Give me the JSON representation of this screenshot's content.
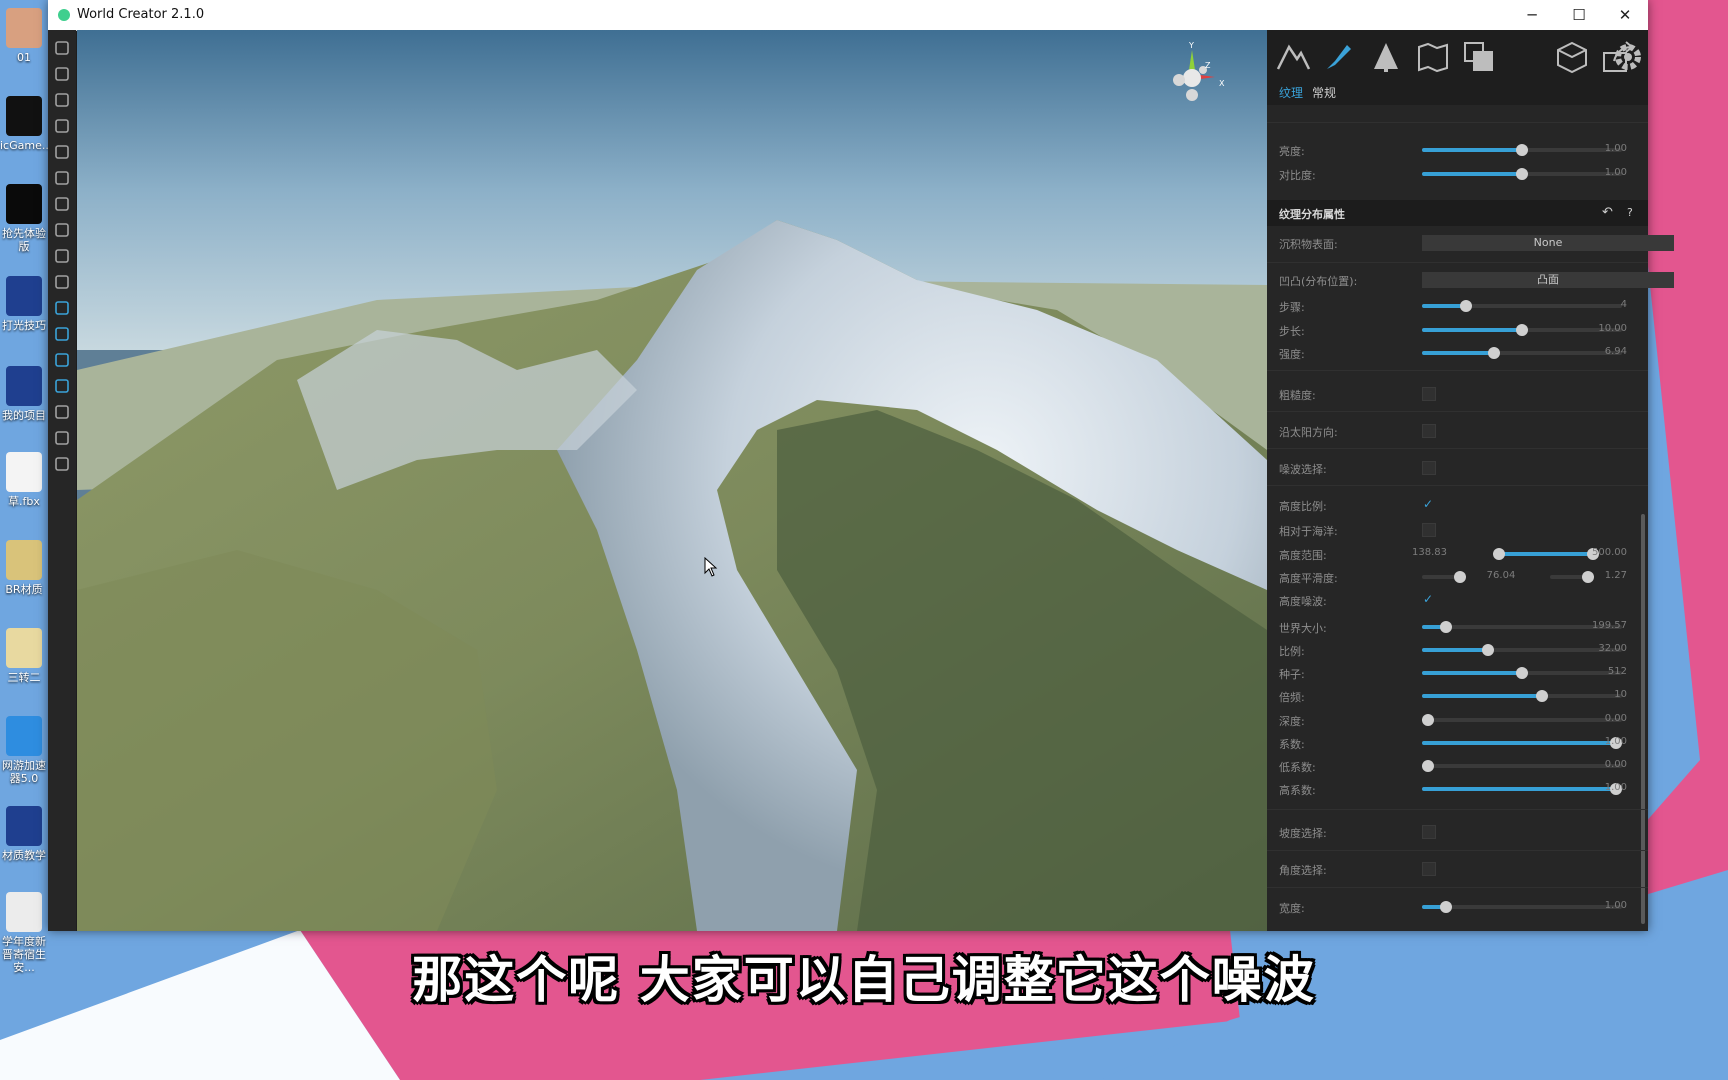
{
  "window": {
    "title": "World Creator 2.1.0",
    "minimize": "─",
    "maximize": "☐",
    "close": "✕"
  },
  "desktop_icons": [
    {
      "label": "01",
      "color": "#d8a080"
    },
    {
      "label": "icGame...",
      "color": "#111111"
    },
    {
      "label": "抢先体验版",
      "color": "#0a0a0a"
    },
    {
      "label": "打光技巧",
      "color": "#1f3f8f"
    },
    {
      "label": "我的项目",
      "color": "#1f3f8f"
    },
    {
      "label": "草.fbx",
      "color": "#f4f4f4"
    },
    {
      "label": "BR材质",
      "color": "#d9c37a"
    },
    {
      "label": "三转二",
      "color": "#e8d9a0"
    },
    {
      "label": "网游加速器5.0",
      "color": "#2e8de0"
    },
    {
      "label": "材质教学",
      "color": "#1f3f8f"
    },
    {
      "label": "学年度新晋寄宿生安...",
      "color": "#ececec"
    }
  ],
  "left_toolbar_icons": [
    "new-file-icon",
    "open-folder-icon",
    "save-icon",
    "save-as-icon",
    "export-icon",
    "map-icon",
    "gamepad-icon",
    "brush-icon",
    "target-icon",
    "terrain-icon",
    "mountain-icon",
    "paint-icon",
    "water-icon",
    "grass-icon",
    "road-icon",
    "image-icon",
    "sky-icon"
  ],
  "gizmo": {
    "y": "Y",
    "z": "Z",
    "x": "X"
  },
  "panel": {
    "top_icons": [
      "mountain-icon",
      "brush-icon",
      "tree-icon",
      "map-icon",
      "layers-icon",
      "cube-icon",
      "share-icon",
      "gear-icon"
    ],
    "tabs": {
      "texture": "纹理",
      "general": "常规"
    },
    "brightness": {
      "label": "亮度:",
      "value": "1.00",
      "level": 0.5
    },
    "contrast": {
      "label": "对比度:",
      "value": "1.00",
      "level": 0.5
    },
    "section_title": "纹理分布属性",
    "section_icons": {
      "undo": "↶",
      "help": "?"
    },
    "sediment": {
      "label": "沉积物表面:",
      "value": "None"
    },
    "convexity": {
      "label": "凹凸(分布位置):",
      "value": "凸面"
    },
    "sliders_a": [
      {
        "label": "步骤:",
        "value": "4",
        "level": 0.22
      },
      {
        "label": "步长:",
        "value": "10.00",
        "level": 0.5
      },
      {
        "label": "强度:",
        "value": "6.94",
        "level": 0.36
      }
    ],
    "roughness": {
      "label": "粗糙度:"
    },
    "sun_dir": {
      "label": "沿太阳方向:"
    },
    "noise_sel": {
      "label": "噪波选择:"
    },
    "height_ratio": {
      "label": "高度比例:",
      "check": "✓"
    },
    "relative_ocean": {
      "label": "相对于海洋:"
    },
    "height_range": {
      "label": "高度范围:",
      "min": "138.83",
      "max": "500.00",
      "lo": 0.0,
      "hi": 1.0
    },
    "height_smooth": {
      "label": "高度平滑度:",
      "mid": "76.04",
      "right": "1.27"
    },
    "height_noise": {
      "label": "高度噪波:",
      "check": "✓"
    },
    "sliders_b": [
      {
        "label": "世界大小:",
        "value": "199.57",
        "level": 0.12
      },
      {
        "label": "比例:",
        "value": "32.00",
        "level": 0.33
      },
      {
        "label": "种子:",
        "value": "512",
        "level": 0.5
      },
      {
        "label": "倍频:",
        "value": "10",
        "level": 0.6
      },
      {
        "label": "深度:",
        "value": "0.00",
        "level": 0.03
      },
      {
        "label": "系数:",
        "value": "1.00",
        "level": 0.97
      },
      {
        "label": "低系数:",
        "value": "0.00",
        "level": 0.03
      },
      {
        "label": "高系数:",
        "value": "1.00",
        "level": 0.97
      }
    ],
    "slope_sel": {
      "label": "坡度选择:"
    },
    "angle_sel": {
      "label": "角度选择:"
    },
    "width": {
      "label": "宽度:",
      "value": "1.00",
      "level": 0.12
    }
  },
  "subtitle": "那这个呢 大家可以自己调整它这个噪波",
  "colors": {
    "accent": "#37a0d6",
    "pink": "#e3568f",
    "blue": "#6fa6e0"
  }
}
